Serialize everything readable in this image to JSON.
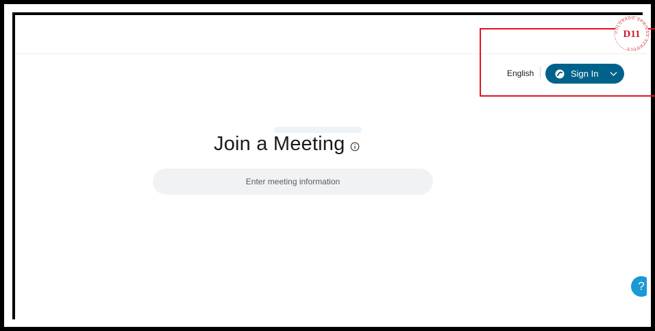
{
  "header": {
    "language_label": "English",
    "signin_label": "Sign In"
  },
  "main": {
    "title": "Join a Meeting",
    "meeting_input_placeholder": "Enter meeting information"
  },
  "help": {
    "glyph": "?"
  },
  "logo": {
    "text": "D11",
    "ring_text": "COLORADO SPRINGS SCHOOLS"
  },
  "colors": {
    "accent": "#00628a",
    "help": "#1a99d3",
    "highlight": "#e3121f",
    "logo": "#d21a2b"
  },
  "icons": {
    "signin": "webex-logo-icon",
    "chevron": "chevron-down-icon",
    "info": "info-icon",
    "help": "help-icon"
  }
}
